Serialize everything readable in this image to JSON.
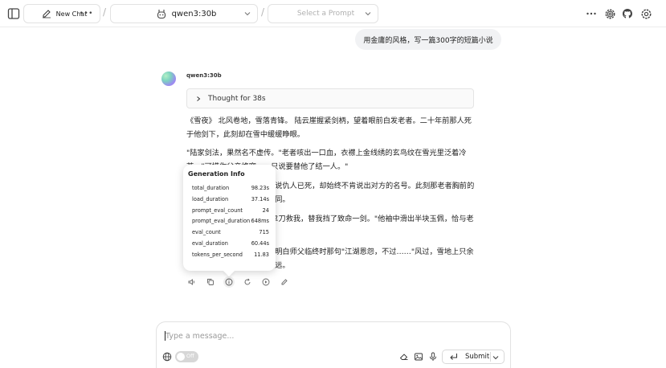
{
  "header": {
    "new_chat_label": "New Chat",
    "separator": "/",
    "model_selected": "qwen3:30b",
    "prompt_placeholder": "Select a Prompt"
  },
  "user_message": "用金庸的风格，写一篇300字的短篇小说",
  "assistant": {
    "model_name": "qwen3:30b",
    "thought_label": "Thought for 38s",
    "paragraphs": [
      "《雪夜》 北风卷地，雪落青锋。 陆云崖握紧剑柄，望着眼前白发老者。二十年前那人死于他剑下，此刻却在雪中缓缓睁眼。",
      "\"陆家剑法，果然名不虚传。\"老者咳出一口血，衣襟上金线绣的玄鸟纹在雪光里泛着冷芒。\"可惜你父亲终究……只说要替他了结一人。\"",
      "他想起临终时攥着他的手，说仇人已死，却始终不肯说出对方的名号。此刻那老者胸前的伤迹，竟与师父伤口形状相同。",
      "陆云崖忽然笑了，\"当年你拿刀救我，替我挡了致命一剑。\"他袖中滑出半块玉佩，恰与老者腰间残玉严丝合缝。",
      "远处似有人影。陆云崖忽然明白师父临终时那句\"江湖恩怨，不过……\"风过，雪地上只余两行脚印，朝着东方渐行渐远。"
    ]
  },
  "generation_info": {
    "title": "Generation Info",
    "rows": [
      {
        "key": "total_duration",
        "value": "98.23s"
      },
      {
        "key": "load_duration",
        "value": "37.14s"
      },
      {
        "key": "prompt_eval_count",
        "value": "24"
      },
      {
        "key": "prompt_eval_duration",
        "value": "648ms"
      },
      {
        "key": "eval_count",
        "value": "715"
      },
      {
        "key": "eval_duration",
        "value": "60.44s"
      },
      {
        "key": "tokens_per_second",
        "value": "11.83"
      }
    ]
  },
  "composer": {
    "placeholder": "Type a message...",
    "toggle_label": "Off",
    "submit_label": "Submit"
  }
}
